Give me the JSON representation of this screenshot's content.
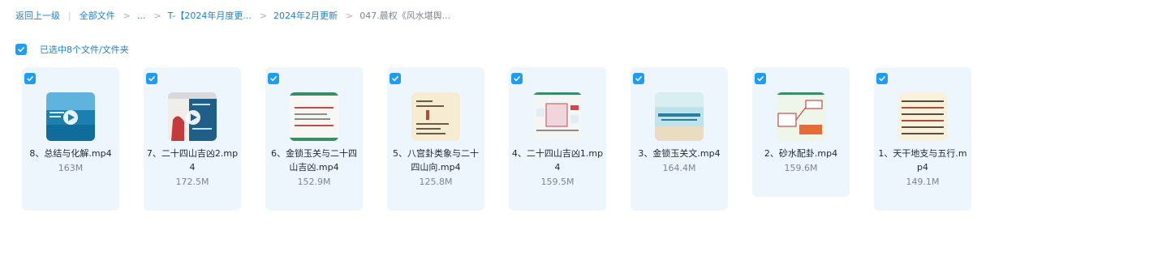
{
  "breadcrumb": {
    "back": "返回上一级",
    "all_files": "全部文件",
    "ellipsis": "...",
    "folder_monthly": "T-【2024年月度更...",
    "folder_feb": "2024年2月更新",
    "current": "047.晨权《风水堪舆..."
  },
  "selection": {
    "text": "已选中8个文件/文件夹"
  },
  "files": [
    {
      "name": "8、总结与化解.mp4",
      "size": "163M",
      "thumb": "video-thumb-blue"
    },
    {
      "name": "7、二十四山吉凶2.mp4",
      "size": "172.5M",
      "thumb": "video-thumb-dark"
    },
    {
      "name": "6、金锁玉关与二十四山吉凶.mp4",
      "size": "152.9M",
      "thumb": "slide-thumb"
    },
    {
      "name": "5、八宫卦类象与二十四山向.mp4",
      "size": "125.8M",
      "thumb": "text-thumb-beige"
    },
    {
      "name": "4、二十四山吉凶1.mp4",
      "size": "159.5M",
      "thumb": "diagram-thumb"
    },
    {
      "name": "3、金锁玉关文.mp4",
      "size": "164.4M",
      "thumb": "sea-thumb"
    },
    {
      "name": "2、砂水配卦.mp4",
      "size": "159.6M",
      "thumb": "map-thumb"
    },
    {
      "name": "1、天干地支与五行.mp4",
      "size": "149.1M",
      "thumb": "text-thumb-cream"
    }
  ],
  "colors": {
    "accent": "#1f9df2",
    "card_bg": "#eef6fd",
    "link": "#1e7fcf"
  }
}
